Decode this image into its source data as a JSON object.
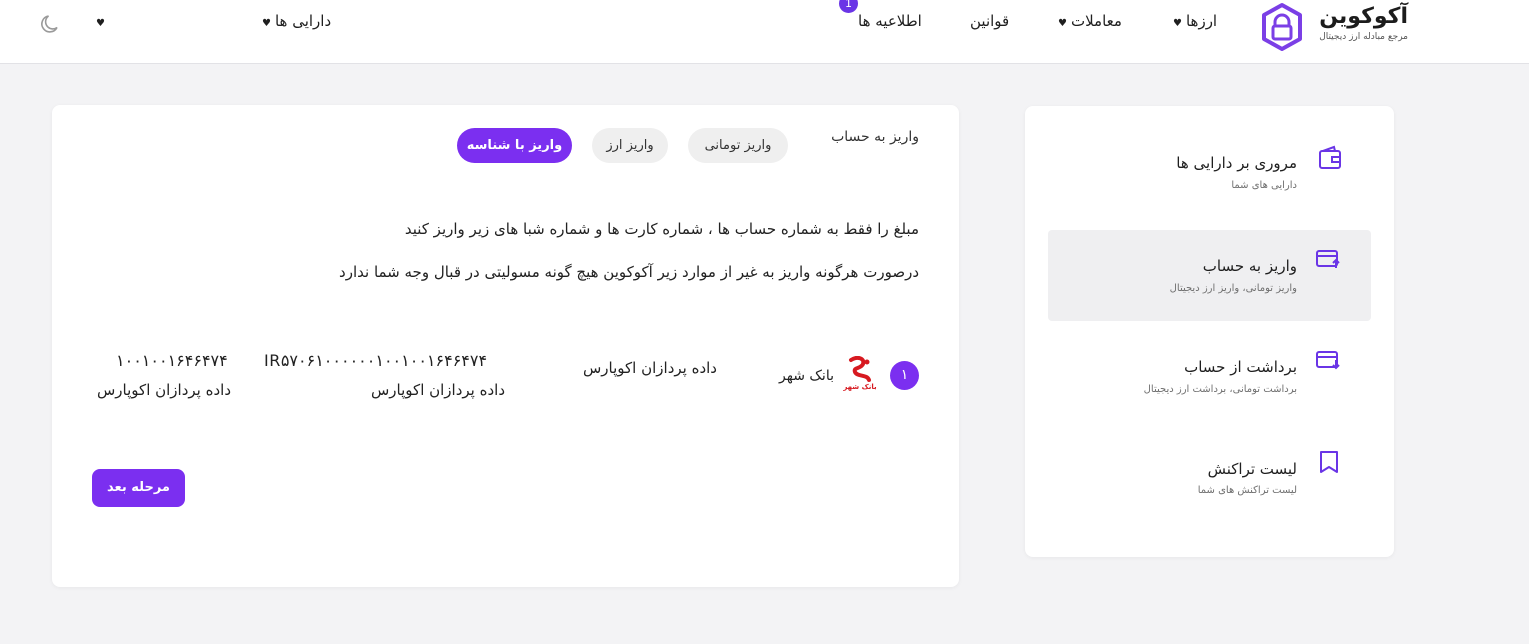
{
  "header": {
    "logo_title": "آکوکوین",
    "logo_subtitle": "مرجع مبادله ارز دیجیتال",
    "nav": [
      {
        "label": "ارزها",
        "has_caret": true
      },
      {
        "label": "معاملات",
        "has_caret": true
      },
      {
        "label": "قوانین",
        "has_caret": false
      },
      {
        "label": "اطلاعیه ها",
        "has_caret": false
      }
    ],
    "notifications_badge": "1",
    "assets_menu_label": "دارایی ها",
    "caret_glyph": "♥",
    "theme_icon": "moon-icon"
  },
  "sidebar": {
    "items": [
      {
        "title": "مروری بر دارایی ها",
        "subtitle": "دارایی های شما",
        "icon": "wallet-icon",
        "active": false
      },
      {
        "title": "واریز به حساب",
        "subtitle": "واریز تومانی، واریز ارز دیجیتال",
        "icon": "card-deposit-icon",
        "active": true
      },
      {
        "title": "برداشت از حساب",
        "subtitle": "برداشت تومانی، برداشت ارز دیجیتال",
        "icon": "card-withdraw-icon",
        "active": false
      },
      {
        "title": "لیست تراکنش",
        "subtitle": "لیست تراکنش های شما",
        "icon": "bookmark-icon",
        "active": false
      }
    ]
  },
  "main": {
    "tabs_label": "واریز به حساب",
    "tabs": [
      {
        "label": "واریز تومانی",
        "active": false
      },
      {
        "label": "واریز ارز",
        "active": false
      },
      {
        "label": "واریز با شناسه",
        "active": true
      }
    ],
    "description_line1": "مبلغ را فقط به شماره حساب ها ، شماره کارت ها و شماره شبا های زیر واریز کنید",
    "description_line2": "درصورت هرگونه واریز به غیر از موارد زیر آکوکوین هیچ گونه مسولیتی در قبال وجه شما ندارد",
    "account": {
      "index": "۱",
      "bank_name": "بانک شهر",
      "bank_logo_text": "بانک شهر",
      "holder": "داده پردازان اکوپارس",
      "sheba": "IR۵۷۰۶۱۰۰۰۰۰۰۱۰۰۱۰۰۱۶۴۶۴۷۴",
      "sheba_holder": "داده پردازان اکوپارس",
      "account_number": "۱۰۰۱۰۰۱۶۴۶۴۷۴",
      "account_holder": "داده پردازان اکوپارس"
    },
    "next_button": "مرحله بعد"
  },
  "colors": {
    "accent": "#7b2ff0",
    "background": "#f3f3f5",
    "card": "#ffffff",
    "bank_red": "#d71920"
  }
}
